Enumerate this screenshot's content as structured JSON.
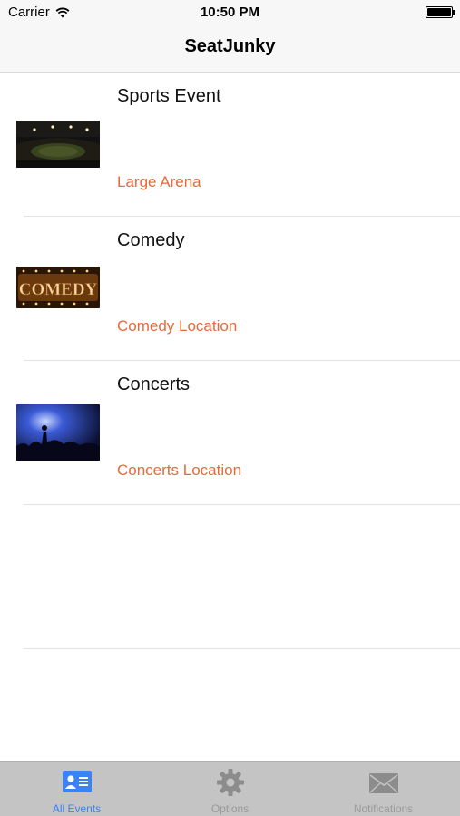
{
  "status": {
    "carrier": "Carrier",
    "time": "10:50 PM"
  },
  "nav": {
    "title": "SeatJunky"
  },
  "colors": {
    "accent": "#e8693a",
    "tab_active": "#3b82f6",
    "tab_inactive": "#9a9a9a"
  },
  "events": [
    {
      "title": "Sports Event",
      "location": "Large Arena",
      "image": "stadium-image"
    },
    {
      "title": "Comedy",
      "location": "Comedy Location",
      "image": "comedy-sign-image"
    },
    {
      "title": "Concerts",
      "location": "Concerts Location",
      "image": "concert-crowd-image"
    }
  ],
  "tabs": [
    {
      "label": "All Events",
      "icon": "contact-card-icon",
      "active": true
    },
    {
      "label": "Options",
      "icon": "gear-icon",
      "active": false
    },
    {
      "label": "Notifications",
      "icon": "envelope-icon",
      "active": false
    }
  ]
}
